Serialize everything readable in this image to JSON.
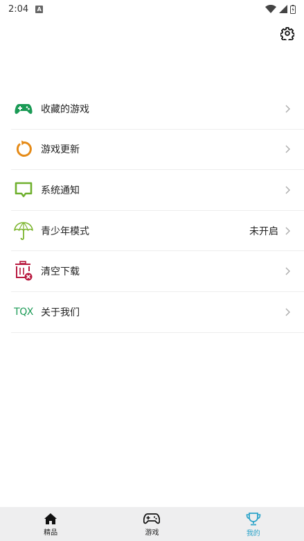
{
  "status_bar": {
    "time": "2:04"
  },
  "menu": {
    "items": [
      {
        "label": "收藏的游戏",
        "value": ""
      },
      {
        "label": "游戏更新",
        "value": ""
      },
      {
        "label": "系统通知",
        "value": ""
      },
      {
        "label": "青少年模式",
        "value": "未开启"
      },
      {
        "label": "清空下载",
        "value": ""
      },
      {
        "label": "关于我们",
        "value": "",
        "icon_text": "TQX"
      }
    ]
  },
  "bottom_nav": {
    "tabs": [
      {
        "label": "精品"
      },
      {
        "label": "游戏"
      },
      {
        "label": "我的"
      }
    ],
    "active_index": 2
  },
  "colors": {
    "accent": "#2aa3c9",
    "green": "#1a9a55",
    "orange": "#e58a17",
    "lime": "#6fb02e",
    "crimson": "#b8193f"
  }
}
